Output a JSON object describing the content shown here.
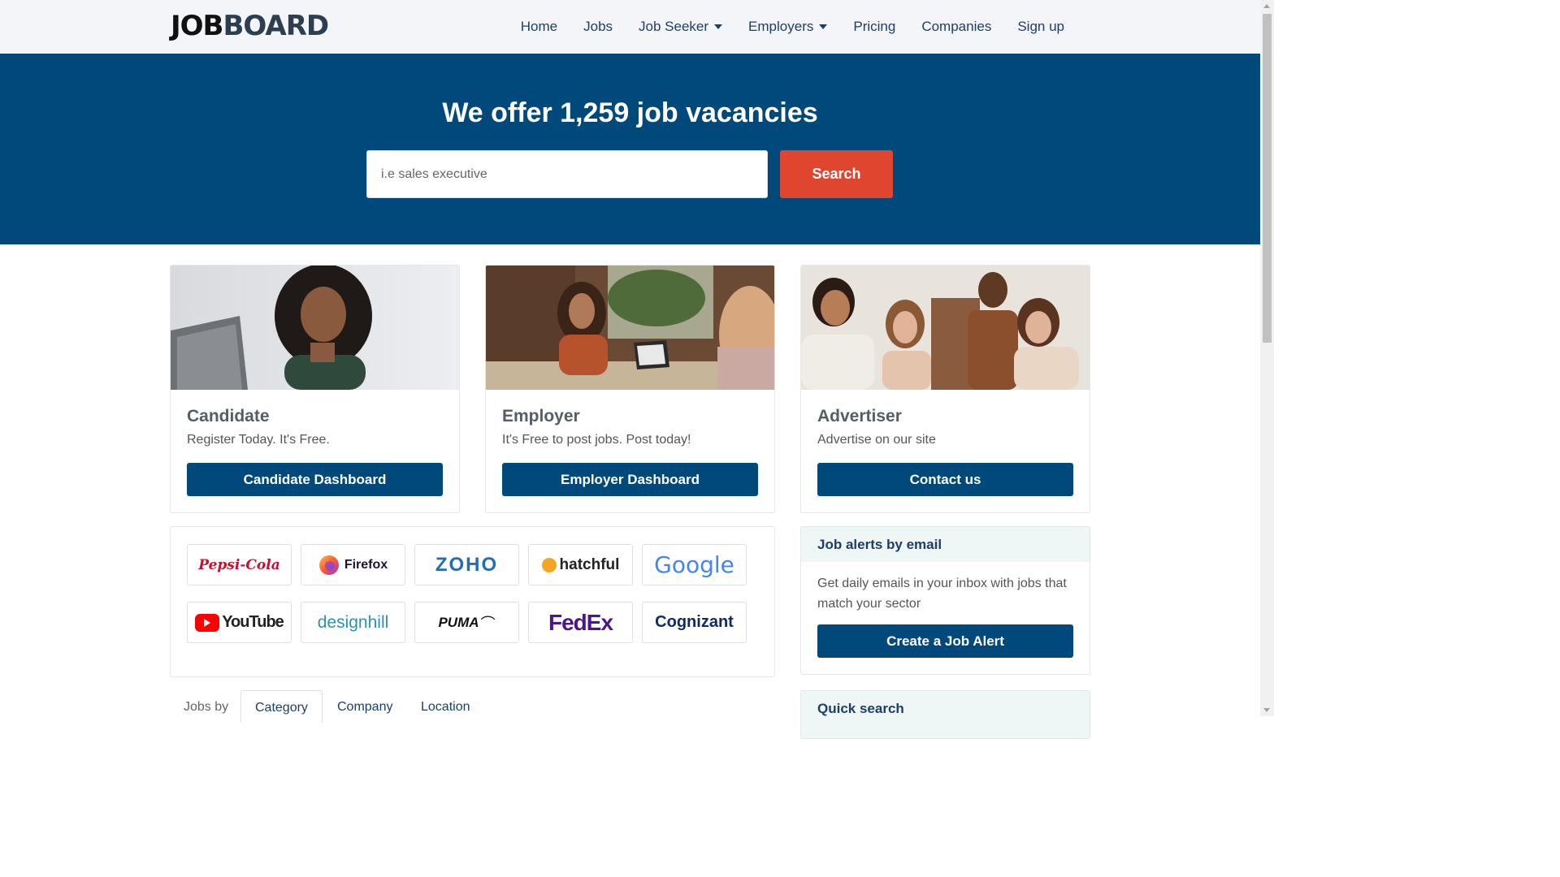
{
  "brand": {
    "part1": "JOB",
    "part2": "BOARD"
  },
  "nav": {
    "home": "Home",
    "jobs": "Jobs",
    "job_seeker": "Job Seeker",
    "employers": "Employers",
    "pricing": "Pricing",
    "companies": "Companies",
    "signup": "Sign up"
  },
  "hero": {
    "title": "We offer 1,259 job vacancies",
    "search_placeholder": "i.e sales executive",
    "search_button": "Search"
  },
  "cards": [
    {
      "title": "Candidate",
      "subtitle": "Register Today. It's Free.",
      "button": "Candidate Dashboard"
    },
    {
      "title": "Employer",
      "subtitle": "It's Free to post jobs. Post today!",
      "button": "Employer Dashboard"
    },
    {
      "title": "Advertiser",
      "subtitle": "Advertise on our site",
      "button": "Contact us"
    }
  ],
  "companies": {
    "pepsi": "Pepsi-Cola",
    "firefox": "Firefox",
    "zoho": "ZOHO",
    "hatchful": "hatchful",
    "google": "Google",
    "youtube": "YouTube",
    "designhill": "designhill",
    "puma": "PUMA",
    "fedex": "FedEx",
    "cognizant": "Cognizant"
  },
  "job_alert": {
    "title": "Job alerts by email",
    "text": "Get daily emails in your inbox with jobs that match your sector",
    "button": "Create a Job Alert"
  },
  "quick_search": {
    "title": "Quick search"
  },
  "jobs_by": {
    "label": "Jobs by",
    "tabs": [
      "Category",
      "Company",
      "Location"
    ]
  },
  "colors": {
    "primary": "#02497b",
    "accent": "#e04530",
    "nav_text": "#1c3f68"
  }
}
